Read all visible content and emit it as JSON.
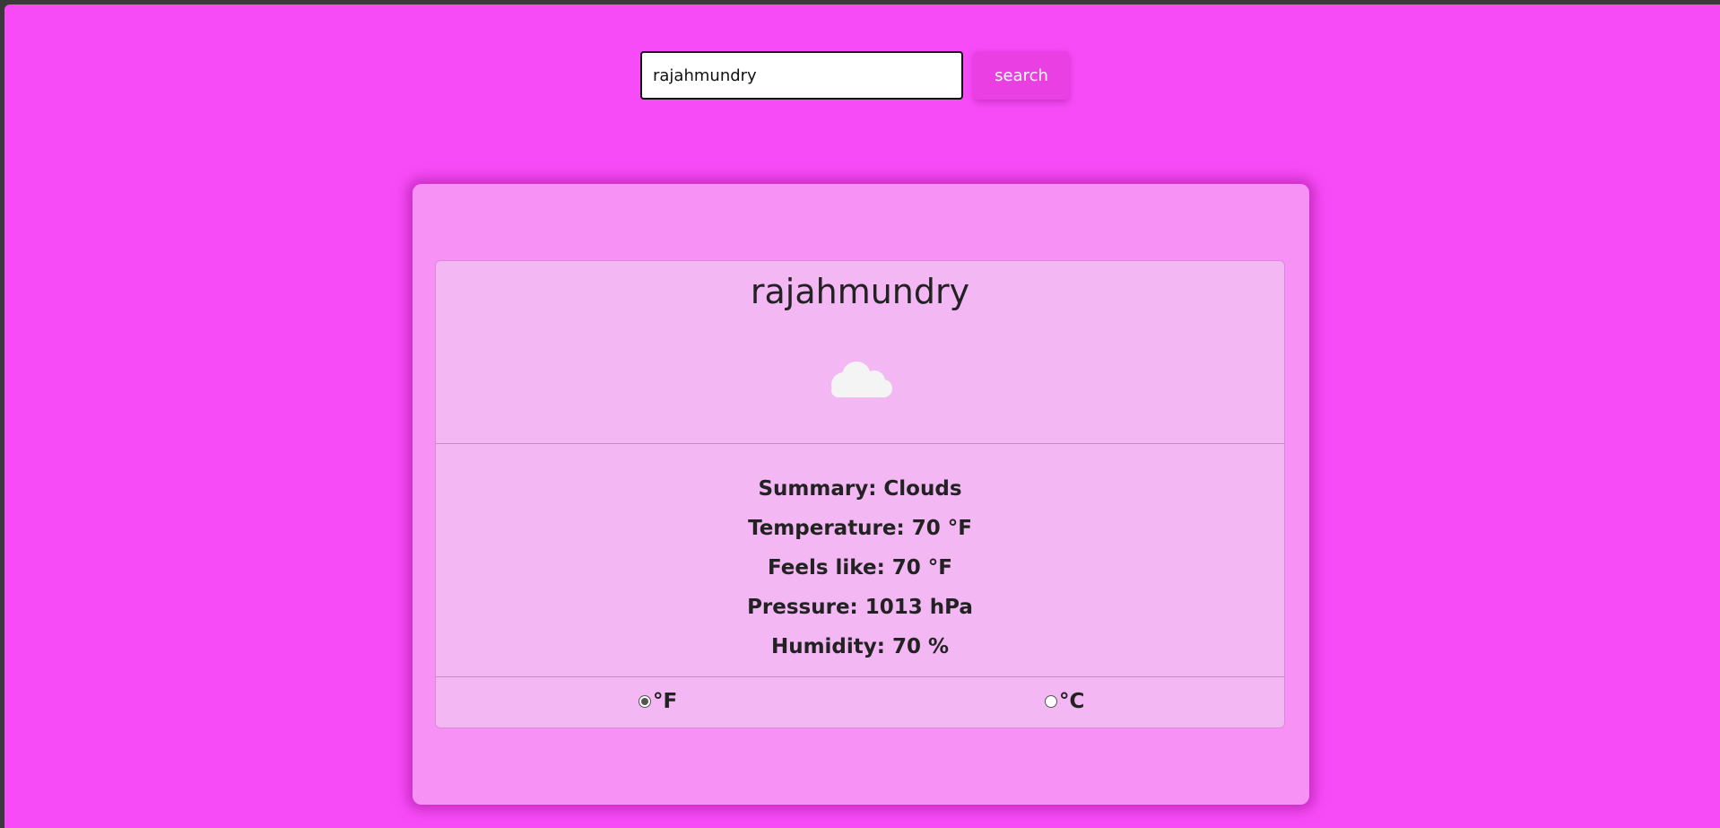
{
  "search": {
    "value": "rajahmundry",
    "button_label": "search"
  },
  "weather": {
    "city": "rajahmundry",
    "icon": "cloud-icon",
    "summary": "Summary: Clouds",
    "temperature": "Temperature: 70 °F",
    "feels_like": "Feels like: 70 °F",
    "pressure": "Pressure: 1013 hPa",
    "humidity": "Humidity: 70 %"
  },
  "units": {
    "fahrenheit_label": "°F",
    "celsius_label": "°C",
    "selected": "fahrenheit"
  },
  "colors": {
    "page_background": "#f74bf7",
    "outer_card": "#f791f5",
    "inner_card": "#f3b7f3",
    "search_button": "#e93fe3"
  }
}
